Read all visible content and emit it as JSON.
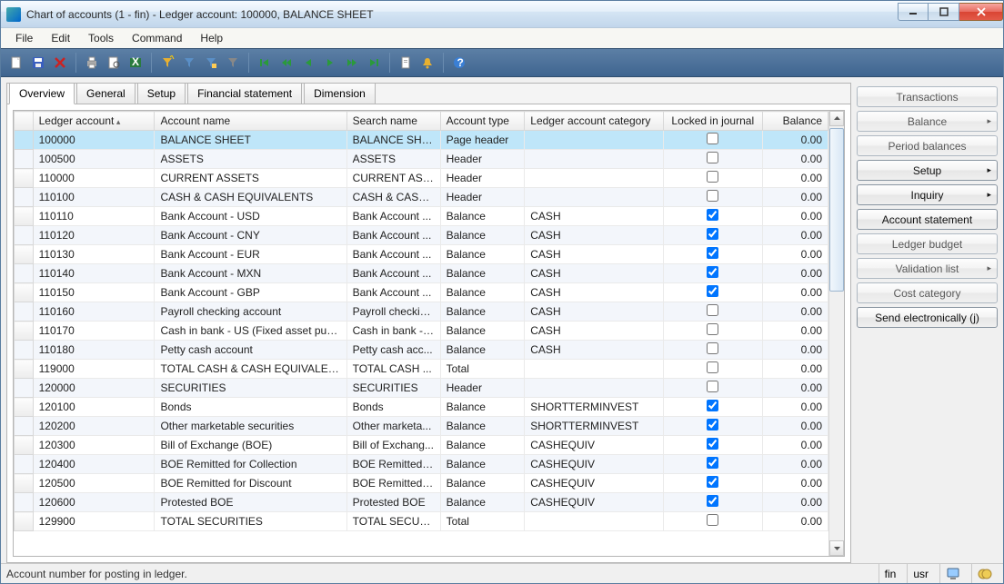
{
  "window": {
    "title": "Chart of accounts (1 - fin) - Ledger account: 100000, BALANCE SHEET"
  },
  "menu": {
    "file": "File",
    "edit": "Edit",
    "tools": "Tools",
    "command": "Command",
    "help": "Help"
  },
  "tabs": {
    "overview": "Overview",
    "general": "General",
    "setup": "Setup",
    "financial": "Financial statement",
    "dimension": "Dimension"
  },
  "columns": {
    "ledger": "Ledger account",
    "name": "Account name",
    "search": "Search name",
    "type": "Account type",
    "category": "Ledger account category",
    "locked": "Locked in journal",
    "balance": "Balance"
  },
  "rows": [
    {
      "ledger": "100000",
      "name": "BALANCE SHEET",
      "search": "BALANCE SHEET",
      "type": "Page header",
      "category": "",
      "locked": false,
      "balance": "0.00",
      "selected": true
    },
    {
      "ledger": "100500",
      "name": "ASSETS",
      "search": "ASSETS",
      "type": "Header",
      "category": "",
      "locked": false,
      "balance": "0.00"
    },
    {
      "ledger": "110000",
      "name": "CURRENT ASSETS",
      "search": "CURRENT ASSE...",
      "type": "Header",
      "category": "",
      "locked": false,
      "balance": "0.00"
    },
    {
      "ledger": "110100",
      "name": "CASH & CASH EQUIVALENTS",
      "search": "CASH & CASH ...",
      "type": "Header",
      "category": "",
      "locked": false,
      "balance": "0.00"
    },
    {
      "ledger": "110110",
      "name": "Bank Account - USD",
      "search": "Bank Account ...",
      "type": "Balance",
      "category": "CASH",
      "locked": true,
      "balance": "0.00"
    },
    {
      "ledger": "110120",
      "name": "Bank Account - CNY",
      "search": "Bank Account ...",
      "type": "Balance",
      "category": "CASH",
      "locked": true,
      "balance": "0.00"
    },
    {
      "ledger": "110130",
      "name": "Bank Account - EUR",
      "search": "Bank Account ...",
      "type": "Balance",
      "category": "CASH",
      "locked": true,
      "balance": "0.00"
    },
    {
      "ledger": "110140",
      "name": "Bank Account - MXN",
      "search": "Bank Account ...",
      "type": "Balance",
      "category": "CASH",
      "locked": true,
      "balance": "0.00"
    },
    {
      "ledger": "110150",
      "name": "Bank Account - GBP",
      "search": "Bank Account ...",
      "type": "Balance",
      "category": "CASH",
      "locked": true,
      "balance": "0.00"
    },
    {
      "ledger": "110160",
      "name": "Payroll checking account",
      "search": "Payroll checkin...",
      "type": "Balance",
      "category": "CASH",
      "locked": false,
      "balance": "0.00"
    },
    {
      "ledger": "110170",
      "name": "Cash in bank - US (Fixed asset purch)",
      "search": "Cash in bank - ...",
      "type": "Balance",
      "category": "CASH",
      "locked": false,
      "balance": "0.00"
    },
    {
      "ledger": "110180",
      "name": "Petty cash account",
      "search": "Petty cash acc...",
      "type": "Balance",
      "category": "CASH",
      "locked": false,
      "balance": "0.00"
    },
    {
      "ledger": "119000",
      "name": "TOTAL CASH & CASH EQUIVALENTS",
      "search": "TOTAL CASH ...",
      "type": "Total",
      "category": "",
      "locked": false,
      "balance": "0.00"
    },
    {
      "ledger": "120000",
      "name": "SECURITIES",
      "search": "SECURITIES",
      "type": "Header",
      "category": "",
      "locked": false,
      "balance": "0.00"
    },
    {
      "ledger": "120100",
      "name": "Bonds",
      "search": "Bonds",
      "type": "Balance",
      "category": "SHORTTERMINVEST",
      "locked": true,
      "balance": "0.00"
    },
    {
      "ledger": "120200",
      "name": "Other marketable securities",
      "search": "Other marketa...",
      "type": "Balance",
      "category": "SHORTTERMINVEST",
      "locked": true,
      "balance": "0.00"
    },
    {
      "ledger": "120300",
      "name": "Bill of Exchange (BOE)",
      "search": "Bill of Exchang...",
      "type": "Balance",
      "category": "CASHEQUIV",
      "locked": true,
      "balance": "0.00"
    },
    {
      "ledger": "120400",
      "name": "BOE Remitted for Collection",
      "search": "BOE Remitted f...",
      "type": "Balance",
      "category": "CASHEQUIV",
      "locked": true,
      "balance": "0.00"
    },
    {
      "ledger": "120500",
      "name": "BOE Remitted for Discount",
      "search": "BOE Remitted f...",
      "type": "Balance",
      "category": "CASHEQUIV",
      "locked": true,
      "balance": "0.00"
    },
    {
      "ledger": "120600",
      "name": "Protested BOE",
      "search": "Protested BOE",
      "type": "Balance",
      "category": "CASHEQUIV",
      "locked": true,
      "balance": "0.00"
    },
    {
      "ledger": "129900",
      "name": "TOTAL SECURITIES",
      "search": "TOTAL SECURI...",
      "type": "Total",
      "category": "",
      "locked": false,
      "balance": "0.00"
    }
  ],
  "side": {
    "transactions": "Transactions",
    "balance": "Balance",
    "period": "Period balances",
    "setup": "Setup",
    "inquiry": "Inquiry",
    "statement": "Account statement",
    "budget": "Ledger budget",
    "validation": "Validation list",
    "cost": "Cost category",
    "send": "Send electronically (",
    "send_j": "j",
    "send_close": ")"
  },
  "status": {
    "msg": "Account number for posting in ledger.",
    "company": "fin",
    "usr": "usr"
  }
}
